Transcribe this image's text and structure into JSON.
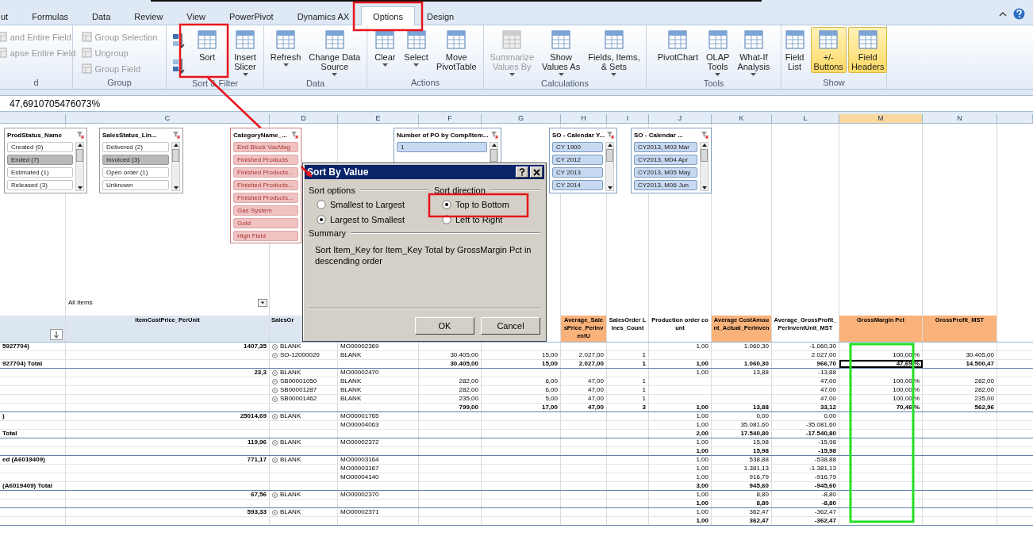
{
  "ribbon": {
    "tabs": [
      {
        "label": "ut",
        "selected": false
      },
      {
        "label": "Formulas",
        "selected": false
      },
      {
        "label": "Data",
        "selected": false
      },
      {
        "label": "Review",
        "selected": false
      },
      {
        "label": "View",
        "selected": false
      },
      {
        "label": "PowerPivot",
        "selected": false
      },
      {
        "label": "Dynamics AX",
        "selected": false
      },
      {
        "label": "Options",
        "selected": true
      },
      {
        "label": "Design",
        "selected": false
      }
    ],
    "groups": [
      {
        "label": "d",
        "items": [
          {
            "kind": "small",
            "label": "and Entire Field",
            "disabled": true
          },
          {
            "kind": "small",
            "label": "apse Entire Field",
            "disabled": true
          }
        ]
      },
      {
        "label": "Group",
        "items": [
          {
            "kind": "small",
            "label": "Group Selection",
            "disabled": true
          },
          {
            "kind": "small",
            "label": "Ungroup",
            "disabled": true
          },
          {
            "kind": "small",
            "label": "Group Field",
            "disabled": true
          }
        ]
      },
      {
        "label": "Sort & Filter",
        "items": [
          {
            "kind": "ascending",
            "disabled": false
          },
          {
            "kind": "descending",
            "disabled": false
          },
          {
            "kind": "large",
            "lines": [
              "Sort"
            ],
            "dropdown": false,
            "disabled": false
          },
          {
            "kind": "large",
            "lines": [
              "Insert",
              "Slicer"
            ],
            "dropdown": true,
            "disabled": false
          }
        ]
      },
      {
        "label": "Data",
        "items": [
          {
            "kind": "large",
            "lines": [
              "Refresh"
            ],
            "dropdown": true,
            "disabled": false
          },
          {
            "kind": "large",
            "lines": [
              "Change Data",
              "Source"
            ],
            "dropdown": true,
            "disabled": false
          }
        ]
      },
      {
        "label": "Actions",
        "items": [
          {
            "kind": "large",
            "lines": [
              "Clear"
            ],
            "dropdown": true,
            "disabled": false
          },
          {
            "kind": "large",
            "lines": [
              "Select"
            ],
            "dropdown": true,
            "disabled": false
          },
          {
            "kind": "large",
            "lines": [
              "Move",
              "PivotTable"
            ],
            "dropdown": false,
            "disabled": false
          }
        ]
      },
      {
        "label": "Calculations",
        "items": [
          {
            "kind": "large",
            "lines": [
              "Summarize",
              "Values By"
            ],
            "dropdown": true,
            "disabled": true
          },
          {
            "kind": "large",
            "lines": [
              "Show",
              "Values As"
            ],
            "dropdown": true,
            "disabled": false
          },
          {
            "kind": "large",
            "lines": [
              "Fields, Items,",
              "& Sets"
            ],
            "dropdown": true,
            "disabled": false
          }
        ]
      },
      {
        "label": "Tools",
        "items": [
          {
            "kind": "large",
            "lines": [
              "PivotChart"
            ],
            "dropdown": false,
            "disabled": false
          },
          {
            "kind": "large",
            "lines": [
              "OLAP",
              "Tools"
            ],
            "dropdown": true,
            "disabled": false
          },
          {
            "kind": "large",
            "lines": [
              "What-If",
              "Analysis"
            ],
            "dropdown": true,
            "disabled": false
          }
        ]
      },
      {
        "label": "Show",
        "items": [
          {
            "kind": "large",
            "lines": [
              "Field",
              "List"
            ],
            "dropdown": false,
            "disabled": false,
            "on": false
          },
          {
            "kind": "large",
            "lines": [
              "+/-",
              "Buttons"
            ],
            "dropdown": false,
            "disabled": false,
            "on": true
          },
          {
            "kind": "large",
            "lines": [
              "Field",
              "Headers"
            ],
            "dropdown": false,
            "disabled": false,
            "on": true
          }
        ]
      }
    ]
  },
  "formula_bar": {
    "value": "47,6910705476073%"
  },
  "column_letters": [
    {
      "label": "C",
      "selected": false
    },
    {
      "label": "D",
      "selected": false
    },
    {
      "label": "E",
      "selected": false
    },
    {
      "label": "F",
      "selected": false
    },
    {
      "label": "G",
      "selected": false
    },
    {
      "label": "H",
      "selected": false
    },
    {
      "label": "I",
      "selected": false
    },
    {
      "label": "J",
      "selected": false
    },
    {
      "label": "K",
      "selected": false
    },
    {
      "label": "L",
      "selected": false
    },
    {
      "label": "M",
      "selected": true
    },
    {
      "label": "N",
      "selected": false
    }
  ],
  "slicers": [
    {
      "title": "ProdStatus_Name",
      "items": [
        {
          "label": "Created (0)",
          "selected": false
        },
        {
          "label": "Ended (7)",
          "selected": true
        },
        {
          "label": "Estimated (1)",
          "selected": false
        },
        {
          "label": "Released (3)",
          "selected": false
        }
      ]
    },
    {
      "title": "SalesStatus_Lin...",
      "items": [
        {
          "label": "Delivered (2)",
          "selected": false
        },
        {
          "label": "Invoiced (3)",
          "selected": true
        },
        {
          "label": "Open order (1)",
          "selected": false
        },
        {
          "label": "Unknown",
          "selected": false
        }
      ]
    },
    {
      "title": "CategoryName_...",
      "items": [
        {
          "label": "End Block VacMag",
          "selected": true
        },
        {
          "label": "Finished Products",
          "selected": true
        },
        {
          "label": "Finished Products...",
          "selected": true
        },
        {
          "label": "Finished Products...",
          "selected": true
        },
        {
          "label": "Finished Products...",
          "selected": true
        },
        {
          "label": "Gas System",
          "selected": true
        },
        {
          "label": "Gold",
          "selected": true
        },
        {
          "label": "High Field",
          "selected": true
        }
      ]
    },
    {
      "title": "Number of PO by Comp/Item...",
      "items": [
        {
          "label": "1",
          "selected": true
        }
      ]
    },
    {
      "title": "SO - Calendar Y...",
      "items": [
        {
          "label": "CY 1900",
          "selected": true
        },
        {
          "label": "CY 2012",
          "selected": true
        },
        {
          "label": "CY 2013",
          "selected": true
        },
        {
          "label": "CY 2014",
          "selected": true
        }
      ]
    },
    {
      "title": "SO - Calendar ...",
      "items": [
        {
          "label": "CY2013, M03 Mar",
          "selected": true
        },
        {
          "label": "CY2013, M04 Apr",
          "selected": true
        },
        {
          "label": "CY2013, M05 May",
          "selected": true
        },
        {
          "label": "CY2013, M06 Jun",
          "selected": true
        }
      ]
    }
  ],
  "page_filter": {
    "value": "All Items"
  },
  "dialog": {
    "title": "Sort By Value",
    "sort_options_label": "Sort options",
    "sort_options": [
      {
        "label": "Smallest to Largest",
        "selected": false
      },
      {
        "label": "Largest to Smallest",
        "selected": true
      }
    ],
    "sort_direction_label": "Sort direction",
    "sort_direction": [
      {
        "label": "Top to Bottom",
        "selected": true
      },
      {
        "label": "Left to Right",
        "selected": false
      }
    ],
    "summary_label": "Summary",
    "summary": "Sort Item_Key for Item_Key Total by GrossMargin Pct in descending order",
    "buttons": [
      "OK",
      "Cancel"
    ]
  },
  "table": {
    "columns": [
      "ItemCostPrice_PerUnit",
      "SalesOr",
      "Average_SalesPrice_PerInventU",
      "SalesOrder Lines_Count",
      "Production order count",
      "Average CostAmount_Actual_PerInven",
      "Average_GrossProfit_PerInventUnit_MST",
      "GrossMargin Pct",
      "GrossProfit_MST"
    ],
    "rows": [
      {
        "total": false,
        "active": false,
        "cells": {
          "a": "5927704)",
          "c": "1407,35",
          "d": "BLANK",
          "e": "MO00002369",
          "j": "1,00",
          "k": "1.060,30",
          "l": "-1.060,30"
        }
      },
      {
        "total": false,
        "active": false,
        "cells": {
          "d": "SO-12000020",
          "e": "BLANK",
          "f": "30.405,00",
          "g": "15,00",
          "h": "2.027,00",
          "i": "1",
          "l": "2.027,00",
          "m": "100,00 %",
          "n": "30.405,00"
        }
      },
      {
        "total": true,
        "active": true,
        "cells": {
          "a": "927704) Total",
          "f": "30.405,00",
          "g": "15,00",
          "h": "2.027,00",
          "i": "1",
          "j": "1,00",
          "k": "1.060,30",
          "l": "966,70",
          "m": "47,69 %",
          "n": "14.500,47"
        }
      },
      {
        "total": false,
        "active": false,
        "cells": {
          "c": "23,3",
          "d": "BLANK",
          "e": "MO00002470",
          "j": "1,00",
          "k": "13,88",
          "l": "-13,88"
        }
      },
      {
        "total": false,
        "active": false,
        "cells": {
          "d": "SB00001050",
          "e": "BLANK",
          "f": "282,00",
          "g": "6,00",
          "h": "47,00",
          "i": "1",
          "l": "47,00",
          "m": "100,00 %",
          "n": "282,00"
        }
      },
      {
        "total": false,
        "active": false,
        "cells": {
          "d": "SB00001287",
          "e": "BLANK",
          "f": "282,00",
          "g": "6,00",
          "h": "47,00",
          "i": "1",
          "l": "47,00",
          "m": "100,00 %",
          "n": "282,00"
        }
      },
      {
        "total": false,
        "active": false,
        "cells": {
          "d": "SB00001462",
          "e": "BLANK",
          "f": "235,00",
          "g": "5,00",
          "h": "47,00",
          "i": "1",
          "l": "47,00",
          "m": "100,00 %",
          "n": "235,00"
        }
      },
      {
        "total": true,
        "active": false,
        "cells": {
          "f": "799,00",
          "g": "17,00",
          "h": "47,00",
          "i": "3",
          "j": "1,00",
          "k": "13,88",
          "l": "33,12",
          "m": "70,46 %",
          "n": "562,96"
        }
      },
      {
        "total": false,
        "active": false,
        "cells": {
          "a": ")",
          "c": "25014,69",
          "d": "BLANK",
          "e": "MO00001765",
          "j": "1,00",
          "k": "0,00",
          "l": "0,00"
        }
      },
      {
        "total": false,
        "active": false,
        "cells": {
          "e": "MO00004063",
          "j": "1,00",
          "k": "35.081,60",
          "l": "-35.081,60"
        }
      },
      {
        "total": true,
        "active": false,
        "cells": {
          "a": "Total",
          "j": "2,00",
          "k": "17.540,80",
          "l": "-17.540,80"
        }
      },
      {
        "total": false,
        "active": false,
        "cells": {
          "c": "119,96",
          "d": "BLANK",
          "e": "MO00002372",
          "j": "1,00",
          "k": "15,98",
          "l": "-15,98"
        }
      },
      {
        "total": true,
        "active": false,
        "cells": {
          "j": "1,00",
          "k": "15,98",
          "l": "-15,98"
        }
      },
      {
        "total": false,
        "active": false,
        "cells": {
          "a": "ed (A6019409)",
          "c": "771,17",
          "d": "BLANK",
          "e": "MO00003164",
          "j": "1,00",
          "k": "538,88",
          "l": "-538,88"
        }
      },
      {
        "total": false,
        "active": false,
        "cells": {
          "e": "MO00003167",
          "j": "1,00",
          "k": "1.381,13",
          "l": "-1.381,13"
        }
      },
      {
        "total": false,
        "active": false,
        "cells": {
          "e": "MO00004140",
          "j": "1,00",
          "k": "916,79",
          "l": "-916,79"
        }
      },
      {
        "total": true,
        "active": false,
        "cells": {
          "a": "(A6019409) Total",
          "j": "3,00",
          "k": "945,60",
          "l": "-945,60"
        }
      },
      {
        "total": false,
        "active": false,
        "cells": {
          "c": "67,56",
          "d": "BLANK",
          "e": "MO00002370",
          "j": "1,00",
          "k": "8,80",
          "l": "-8,80"
        }
      },
      {
        "total": true,
        "active": false,
        "cells": {
          "j": "1,00",
          "k": "8,80",
          "l": "-8,80"
        }
      },
      {
        "total": false,
        "active": false,
        "cells": {
          "c": "593,33",
          "d": "BLANK",
          "e": "MO00002371",
          "j": "1,00",
          "k": "362,47",
          "l": "-362,47"
        }
      },
      {
        "total": true,
        "active": false,
        "cells": {
          "j": "1,00",
          "k": "362,47",
          "l": "-362,47"
        }
      }
    ]
  }
}
